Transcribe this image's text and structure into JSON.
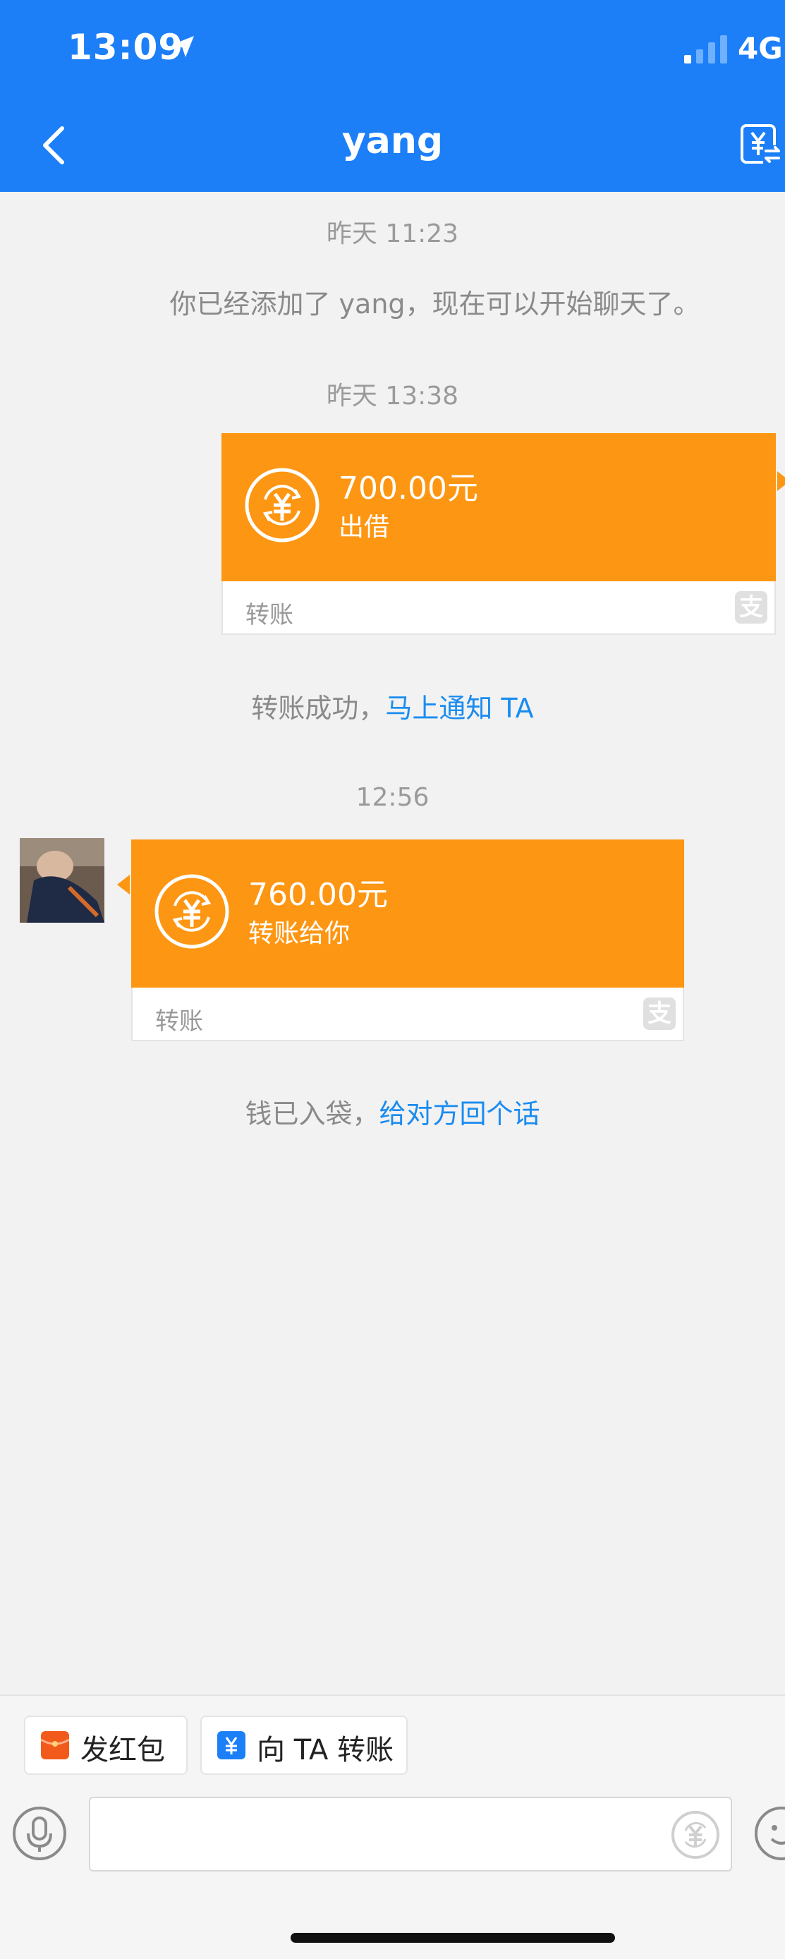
{
  "status_bar": {
    "time": "13:09",
    "network": "4G"
  },
  "header": {
    "title": "yang"
  },
  "messages": {
    "ts1": "昨天 11:23",
    "added_notice": "你已经添加了 yang，现在可以开始聊天了。",
    "ts2": "昨天 13:38",
    "sent_transfer": {
      "amount": "700.00元",
      "desc": "出借",
      "label": "转账"
    },
    "success_prefix": "转账成功，",
    "success_link": "马上通知 TA",
    "ts3": "12:56",
    "received_transfer": {
      "amount": "760.00元",
      "desc": "转账给你",
      "label": "转账"
    },
    "received_prefix": "钱已入袋，",
    "received_link": "给对方回个话"
  },
  "bottom": {
    "red_packet_label": "发红包",
    "transfer_label": "向 TA 转账",
    "input_value": ""
  },
  "colors": {
    "header": "#1c7ff8",
    "card": "#fd9612",
    "link": "#1a8cf0"
  }
}
